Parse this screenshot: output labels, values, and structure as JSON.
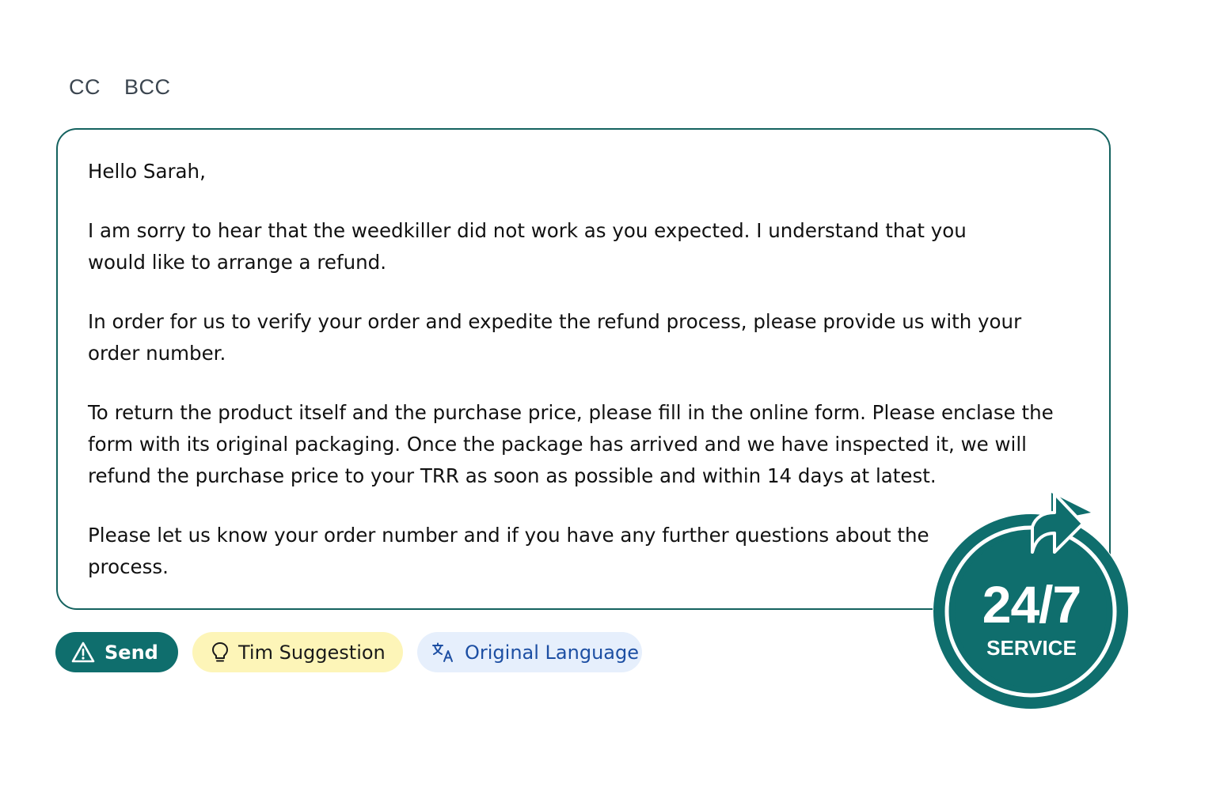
{
  "header": {
    "cc_label": "CC",
    "bcc_label": "BCC"
  },
  "message": {
    "greeting": "Hello Sarah,",
    "paragraphs": [
      "I am sorry to hear that the weedkiller did not work as you expected. I understand that you would like to arrange a refund.",
      "In order for us to verify your order and expedite the refund process, please provide us with your order number.",
      "To return the product itself and the purchase price, please fill in the online form. Please enclase the form with its original packaging. Once the package has arrived and we have inspected it, we will refund the purchase price to your TRR as soon as possible and within 14 days at latest.",
      "Please let us know your order number and if you have any further questions about the process."
    ]
  },
  "actions": {
    "send_label": "Send",
    "send_icon": "warning-triangle-icon",
    "suggestion_label": "Tim Suggestion",
    "suggestion_icon": "lightbulb-icon",
    "language_label": "Original Language",
    "language_icon": "translate-icon"
  },
  "badge": {
    "number": "24/7",
    "label": "SERVICE"
  },
  "colors": {
    "accent": "#0f6e6d",
    "border": "#14625f",
    "suggestion_bg": "#fdf5b8",
    "language_bg": "#e6effc",
    "language_text": "#1d4fa3"
  }
}
